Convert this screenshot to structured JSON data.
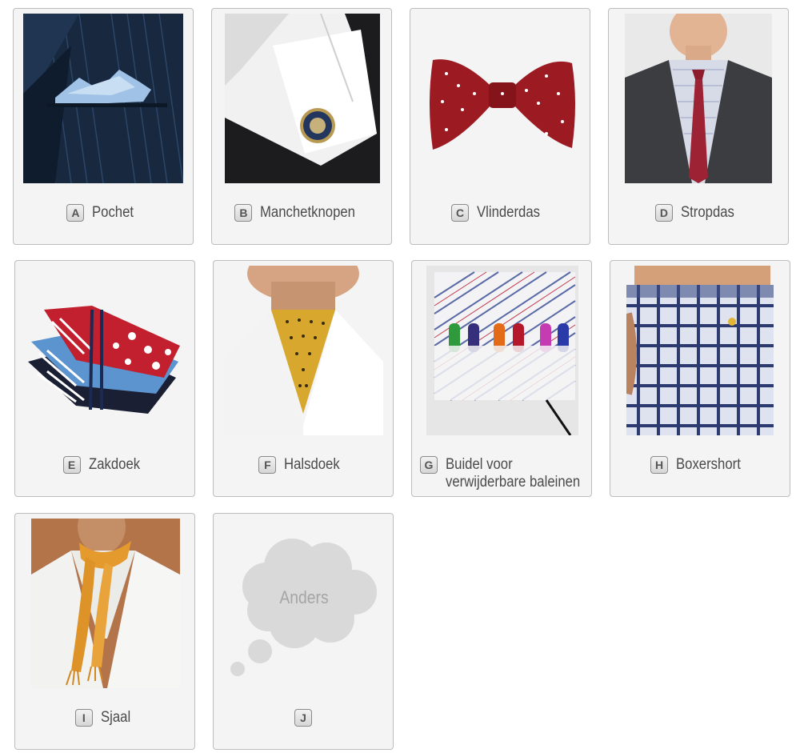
{
  "options": [
    {
      "letter": "A",
      "label": "Pochet",
      "image": "pocket-square-photo"
    },
    {
      "letter": "B",
      "label": "Manchetknopen",
      "image": "cufflinks-photo"
    },
    {
      "letter": "C",
      "label": "Vlinderdas",
      "image": "bow-tie-photo"
    },
    {
      "letter": "D",
      "label": "Stropdas",
      "image": "necktie-photo"
    },
    {
      "letter": "E",
      "label": "Zakdoek",
      "image": "handkerchief-photo"
    },
    {
      "letter": "F",
      "label": "Halsdoek",
      "image": "cravat-photo"
    },
    {
      "letter": "G",
      "label_line1": "Buidel voor",
      "label_line2": "verwijderbare baleinen",
      "image": "collar-stay-pouch-photo"
    },
    {
      "letter": "H",
      "label": "Boxershort",
      "image": "boxer-shorts-photo"
    },
    {
      "letter": "I",
      "label": "Sjaal",
      "image": "scarf-photo"
    },
    {
      "letter": "J",
      "label": "",
      "placeholder": "Anders",
      "image": "thought-cloud-icon"
    }
  ],
  "colors": {
    "card_bg": "#f4f4f4",
    "card_border": "#bdbdbd",
    "label_text": "#4a4a4a",
    "placeholder_text": "#a5a5a5"
  }
}
